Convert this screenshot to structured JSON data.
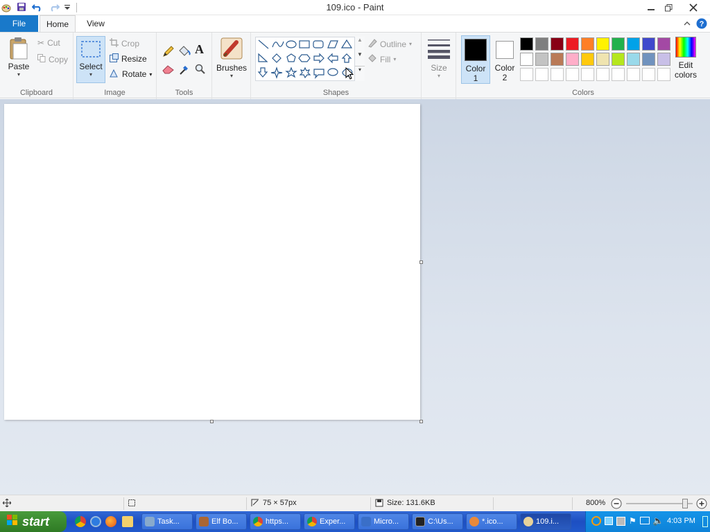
{
  "window": {
    "title": "109.ico - Paint"
  },
  "tabs": {
    "file": "File",
    "home": "Home",
    "view": "View"
  },
  "clipboard": {
    "paste": "Paste",
    "cut": "Cut",
    "copy": "Copy",
    "label": "Clipboard"
  },
  "image": {
    "select": "Select",
    "crop": "Crop",
    "resize": "Resize",
    "rotate": "Rotate",
    "label": "Image"
  },
  "tools": {
    "label": "Tools"
  },
  "brushes": {
    "label": "Brushes"
  },
  "shapes": {
    "outline": "Outline",
    "fill": "Fill",
    "label": "Shapes"
  },
  "size": {
    "label": "Size"
  },
  "colors": {
    "color1_line1": "Color",
    "color1_line2": "1",
    "color2_line1": "Color",
    "color2_line2": "2",
    "edit_line1": "Edit",
    "edit_line2": "colors",
    "label": "Colors",
    "color1_value": "#000000",
    "color2_value": "#ffffff",
    "palette_row1": [
      "#000000",
      "#7f7f7f",
      "#880015",
      "#ed1c24",
      "#ff7f27",
      "#fff200",
      "#22b14c",
      "#00a2e8",
      "#3f48cc",
      "#a349a4"
    ],
    "palette_row2": [
      "#ffffff",
      "#c3c3c3",
      "#b97a57",
      "#ffaec9",
      "#ffc90e",
      "#efe4b0",
      "#b5e61d",
      "#99d9ea",
      "#7092be",
      "#c8bfe7"
    ],
    "palette_row3": [
      "#ffffff",
      "#ffffff",
      "#ffffff",
      "#ffffff",
      "#ffffff",
      "#ffffff",
      "#ffffff",
      "#ffffff",
      "#ffffff",
      "#ffffff"
    ]
  },
  "status": {
    "dimensions": "75 × 57px",
    "size": "Size: 131.6KB",
    "zoom": "800%"
  },
  "taskbar": {
    "start": "start",
    "buttons": [
      "Task...",
      "Elf Bo...",
      "https...",
      "Exper...",
      "Micro...",
      "C:\\Us...",
      "*.ico...",
      "109.i..."
    ],
    "clock": "4:03 PM"
  }
}
